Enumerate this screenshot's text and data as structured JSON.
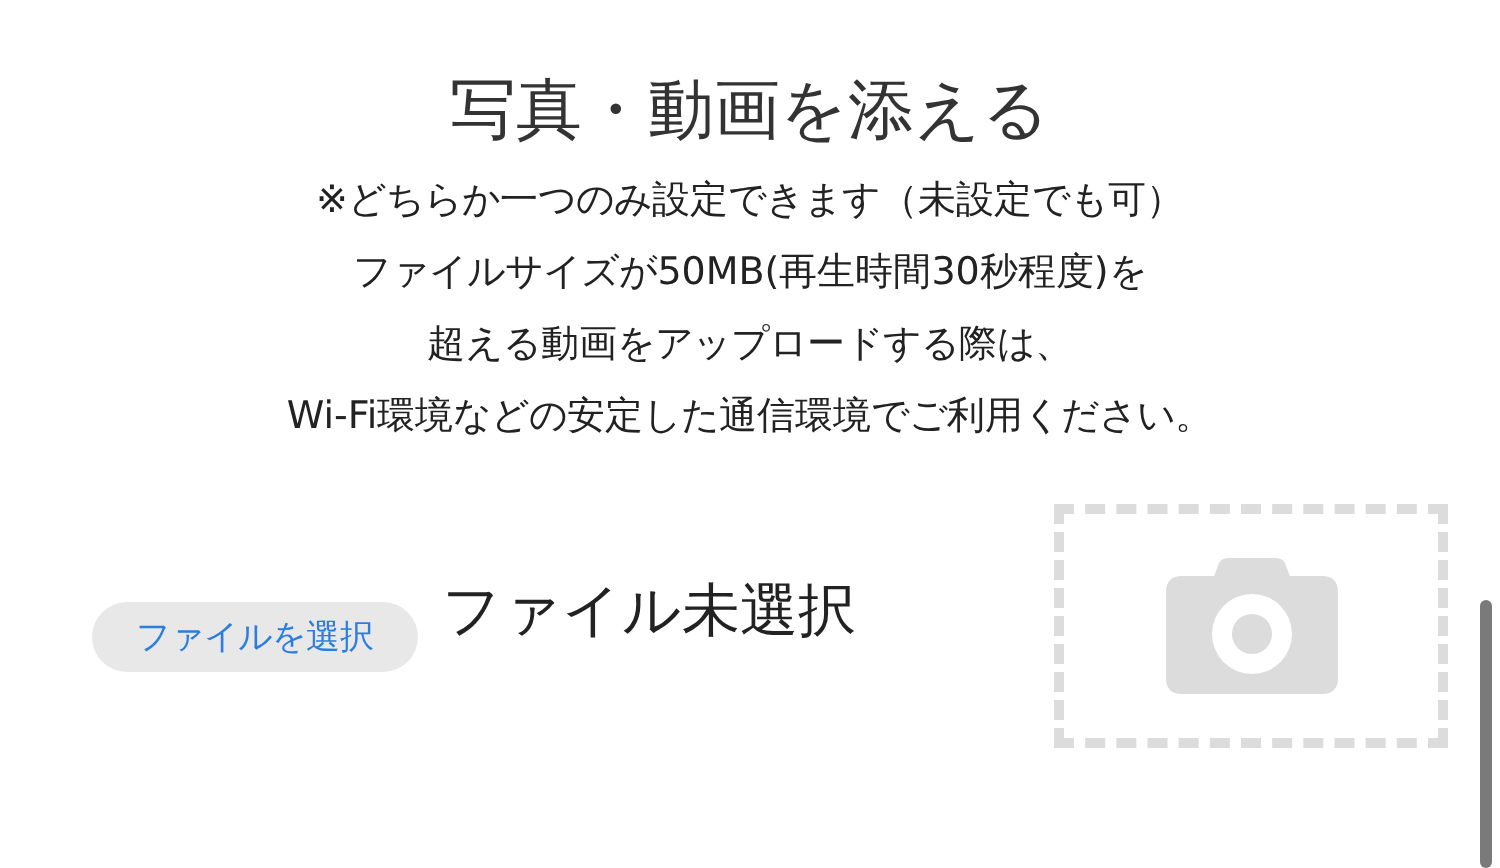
{
  "heading": {
    "title": "写真・動画を添える"
  },
  "notes": [
    "※どちらか一つのみ設定できます（未設定でも可）",
    "ファイルサイズが50MB(再生時間30秒程度)を",
    "超える動画をアップロードする際は、",
    "Wi-Fi環境などの安定した通信環境でご利用ください。"
  ],
  "file_input": {
    "button": "ファイルを選択",
    "status": "ファイル未選択"
  }
}
